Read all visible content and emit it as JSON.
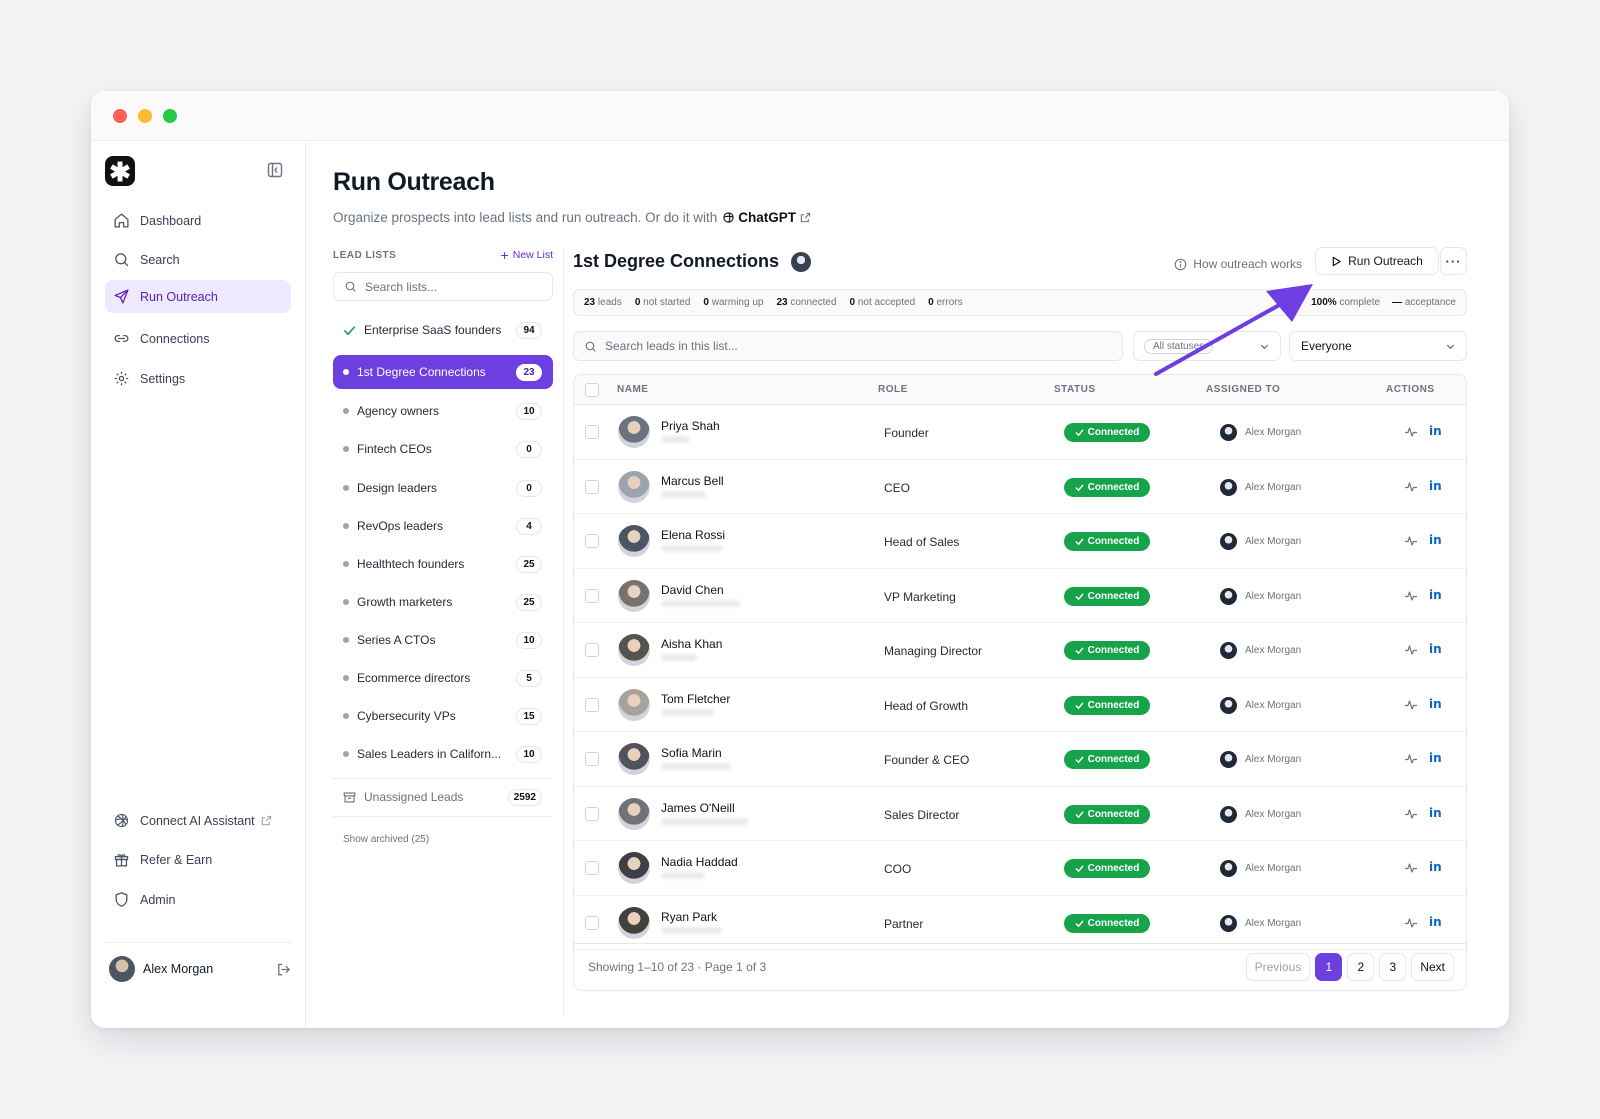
{
  "sidebar": {
    "nav": [
      {
        "label": "Dashboard",
        "icon": "home-icon"
      },
      {
        "label": "Search",
        "icon": "search-icon"
      },
      {
        "label": "Run Outreach",
        "icon": "send-icon"
      },
      {
        "label": "Connections",
        "icon": "link-icon"
      },
      {
        "label": "Settings",
        "icon": "gear-icon"
      }
    ],
    "bottom": [
      {
        "label": "Connect AI Assistant",
        "icon": "openai-icon"
      },
      {
        "label": "Refer & Earn",
        "icon": "gift-icon"
      },
      {
        "label": "Admin",
        "icon": "shield-icon"
      }
    ],
    "user": {
      "name": "Alex Morgan"
    }
  },
  "page": {
    "title": "Run Outreach",
    "subtitle": "Organize prospects into lead lists and run outreach. Or do it with",
    "chatgpt": "ChatGPT"
  },
  "lead_lists": {
    "heading": "LEAD LISTS",
    "new_list": "New List",
    "search_placeholder": "Search lists...",
    "items": [
      {
        "name": "Enterprise SaaS founders",
        "count": "94"
      },
      {
        "name": "1st Degree Connections",
        "count": "23"
      },
      {
        "name": "Agency owners",
        "count": "10"
      },
      {
        "name": "Fintech CEOs",
        "count": "0"
      },
      {
        "name": "Design leaders",
        "count": "0"
      },
      {
        "name": "RevOps leaders",
        "count": "4"
      },
      {
        "name": "Healthtech founders",
        "count": "25"
      },
      {
        "name": "Growth marketers",
        "count": "25"
      },
      {
        "name": "Series A CTOs",
        "count": "10"
      },
      {
        "name": "Ecommerce directors",
        "count": "5"
      },
      {
        "name": "Cybersecurity VPs",
        "count": "15"
      },
      {
        "name": "Sales Leaders in Californ...",
        "count": "10"
      }
    ],
    "unassigned": {
      "name": "Unassigned Leads",
      "count": "2592"
    },
    "show_archived": "Show archived (25)"
  },
  "leads": {
    "title": "1st Degree Connections",
    "how": "How outreach works",
    "run_button": "Run Outreach",
    "more": "···",
    "stats": [
      {
        "num": "23",
        "label": "leads"
      },
      {
        "num": "0",
        "label": "not started"
      },
      {
        "num": "0",
        "label": "warming up"
      },
      {
        "num": "23",
        "label": "connected"
      },
      {
        "num": "0",
        "label": "not accepted"
      },
      {
        "num": "0",
        "label": "errors"
      }
    ],
    "stats_right": [
      {
        "num": "100%",
        "label": "complete"
      },
      {
        "num": "—",
        "label": "acceptance"
      }
    ],
    "search_placeholder": "Search leads in this list...",
    "status_filter": "All statuses",
    "assign_filter": "Everyone",
    "columns": {
      "name": "NAME",
      "role": "ROLE",
      "status": "STATUS",
      "assigned": "ASSIGNED TO",
      "actions": "ACTIONS"
    },
    "rows": [
      {
        "name": "Priya Shah",
        "role": "Founder",
        "status": "Connected",
        "assigned": "Alex Morgan"
      },
      {
        "name": "Marcus Bell",
        "role": "CEO",
        "status": "Connected",
        "assigned": "Alex Morgan"
      },
      {
        "name": "Elena Rossi",
        "role": "Head of Sales",
        "status": "Connected",
        "assigned": "Alex Morgan"
      },
      {
        "name": "David Chen",
        "role": "VP Marketing",
        "status": "Connected",
        "assigned": "Alex Morgan"
      },
      {
        "name": "Aisha Khan",
        "role": "Managing Director",
        "status": "Connected",
        "assigned": "Alex Morgan"
      },
      {
        "name": "Tom Fletcher",
        "role": "Head of Growth",
        "status": "Connected",
        "assigned": "Alex Morgan"
      },
      {
        "name": "Sofia Marin",
        "role": "Founder & CEO",
        "status": "Connected",
        "assigned": "Alex Morgan"
      },
      {
        "name": "James O'Neill",
        "role": "Sales Director",
        "status": "Connected",
        "assigned": "Alex Morgan"
      },
      {
        "name": "Nadia Haddad",
        "role": "COO",
        "status": "Connected",
        "assigned": "Alex Morgan"
      },
      {
        "name": "Ryan Park",
        "role": "Partner",
        "status": "Connected",
        "assigned": "Alex Morgan"
      }
    ],
    "footer": "Showing 1–10 of 23 · Page 1 of 3",
    "pager": {
      "previous": "Previous",
      "pages": [
        "1",
        "2",
        "3"
      ],
      "next": "Next",
      "current_page": 1
    },
    "linkedin_glyph": "in"
  },
  "colors": {
    "accent": "#6d3ee0",
    "connected": "#16a34a",
    "arrow": "#6d3ee0"
  }
}
